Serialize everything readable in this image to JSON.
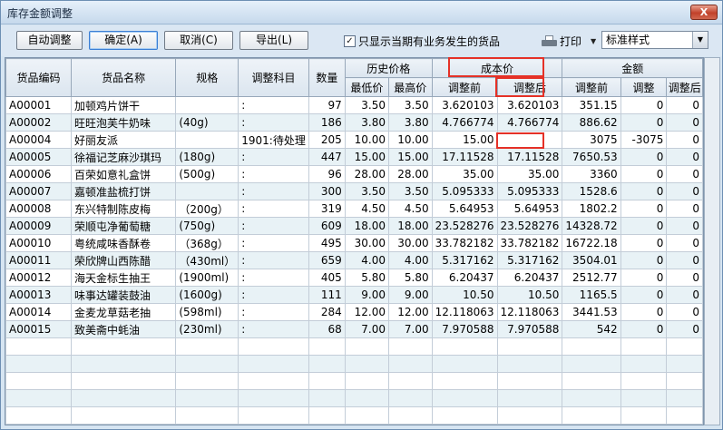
{
  "window": {
    "title": "库存金额调整",
    "close_label": "X"
  },
  "toolbar": {
    "auto_adjust": "自动调整",
    "confirm": "确定(A)",
    "cancel": "取消(C)",
    "export": "导出(L)",
    "only_business_label": "只显示当期有业务发生的货品",
    "only_business_checked": true,
    "print_label": "打印",
    "style_value": "标准样式"
  },
  "grid": {
    "headers": {
      "code": "货品编码",
      "name": "货品名称",
      "spec": "规格",
      "account": "调整科目",
      "qty": "数量",
      "history_price": "历史价格",
      "min_price": "最低价",
      "max_price": "最高价",
      "cost_price": "成本价",
      "cost_before": "调整前",
      "cost_after": "调整后",
      "amount": "金额",
      "amt_before": "调整前",
      "amt_adjust": "调整",
      "amt_after": "调整后"
    },
    "rows": [
      {
        "code": "A00001",
        "name": "加顿鸡片饼干",
        "spec": "",
        "account": ":",
        "qty": "97",
        "min": "3.50",
        "max": "3.50",
        "cb": "3.620103",
        "ca": "3.620103",
        "ab": "351.15",
        "adj": "0",
        "aa": "0"
      },
      {
        "code": "A00002",
        "name": "旺旺泡芙牛奶味",
        "spec": "(40g)",
        "account": ":",
        "qty": "186",
        "min": "3.80",
        "max": "3.80",
        "cb": "4.766774",
        "ca": "4.766774",
        "ab": "886.62",
        "adj": "0",
        "aa": "0"
      },
      {
        "code": "A00004",
        "name": "好丽友派",
        "spec": "",
        "account": "1901:待处理",
        "qty": "205",
        "min": "10.00",
        "max": "10.00",
        "cb": "15.00",
        "ca": "",
        "ab": "3075",
        "adj": "-3075",
        "aa": "0"
      },
      {
        "code": "A00005",
        "name": "徐福记芝麻沙琪玛",
        "spec": "(180g)",
        "account": ":",
        "qty": "447",
        "min": "15.00",
        "max": "15.00",
        "cb": "17.11528",
        "ca": "17.11528",
        "ab": "7650.53",
        "adj": "0",
        "aa": "0"
      },
      {
        "code": "A00006",
        "name": "百荣如意礼盒饼",
        "spec": "(500g)",
        "account": ":",
        "qty": "96",
        "min": "28.00",
        "max": "28.00",
        "cb": "35.00",
        "ca": "35.00",
        "ab": "3360",
        "adj": "0",
        "aa": "0"
      },
      {
        "code": "A00007",
        "name": "嘉顿准盐梳打饼",
        "spec": "",
        "account": ":",
        "qty": "300",
        "min": "3.50",
        "max": "3.50",
        "cb": "5.095333",
        "ca": "5.095333",
        "ab": "1528.6",
        "adj": "0",
        "aa": "0"
      },
      {
        "code": "A00008",
        "name": "东兴特制陈皮梅",
        "spec": "（200g）",
        "account": ":",
        "qty": "319",
        "min": "4.50",
        "max": "4.50",
        "cb": "5.64953",
        "ca": "5.64953",
        "ab": "1802.2",
        "adj": "0",
        "aa": "0"
      },
      {
        "code": "A00009",
        "name": "荣顺屯净葡萄糖",
        "spec": "(750g)",
        "account": ":",
        "qty": "609",
        "min": "18.00",
        "max": "18.00",
        "cb": "23.528276",
        "ca": "23.528276",
        "ab": "14328.72",
        "adj": "0",
        "aa": "0"
      },
      {
        "code": "A00010",
        "name": "粤统咸味香酥卷",
        "spec": "（368g）",
        "account": ":",
        "qty": "495",
        "min": "30.00",
        "max": "30.00",
        "cb": "33.782182",
        "ca": "33.782182",
        "ab": "16722.18",
        "adj": "0",
        "aa": "0"
      },
      {
        "code": "A00011",
        "name": "荣欣牌山西陈醋",
        "spec": "（430ml）",
        "account": ":",
        "qty": "659",
        "min": "4.00",
        "max": "4.00",
        "cb": "5.317162",
        "ca": "5.317162",
        "ab": "3504.01",
        "adj": "0",
        "aa": "0"
      },
      {
        "code": "A00012",
        "name": "海天金标生抽王",
        "spec": "(1900ml)",
        "account": ":",
        "qty": "405",
        "min": "5.80",
        "max": "5.80",
        "cb": "6.20437",
        "ca": "6.20437",
        "ab": "2512.77",
        "adj": "0",
        "aa": "0"
      },
      {
        "code": "A00013",
        "name": "味事达罐装鼓油",
        "spec": "(1600g)",
        "account": ":",
        "qty": "111",
        "min": "9.00",
        "max": "9.00",
        "cb": "10.50",
        "ca": "10.50",
        "ab": "1165.5",
        "adj": "0",
        "aa": "0"
      },
      {
        "code": "A00014",
        "name": "金麦龙草菇老抽",
        "spec": "(598ml)",
        "account": ":",
        "qty": "284",
        "min": "12.00",
        "max": "12.00",
        "cb": "12.118063",
        "ca": "12.118063",
        "ab": "3441.53",
        "adj": "0",
        "aa": "0"
      },
      {
        "code": "A00015",
        "name": "致美斋中蚝油",
        "spec": "(230ml)",
        "account": ":",
        "qty": "68",
        "min": "7.00",
        "max": "7.00",
        "cb": "7.970588",
        "ca": "7.970588",
        "ab": "542",
        "adj": "0",
        "aa": "0"
      }
    ]
  },
  "colors": {
    "highlight_red": "#e53127",
    "row_alt": "#e8f2f6"
  }
}
